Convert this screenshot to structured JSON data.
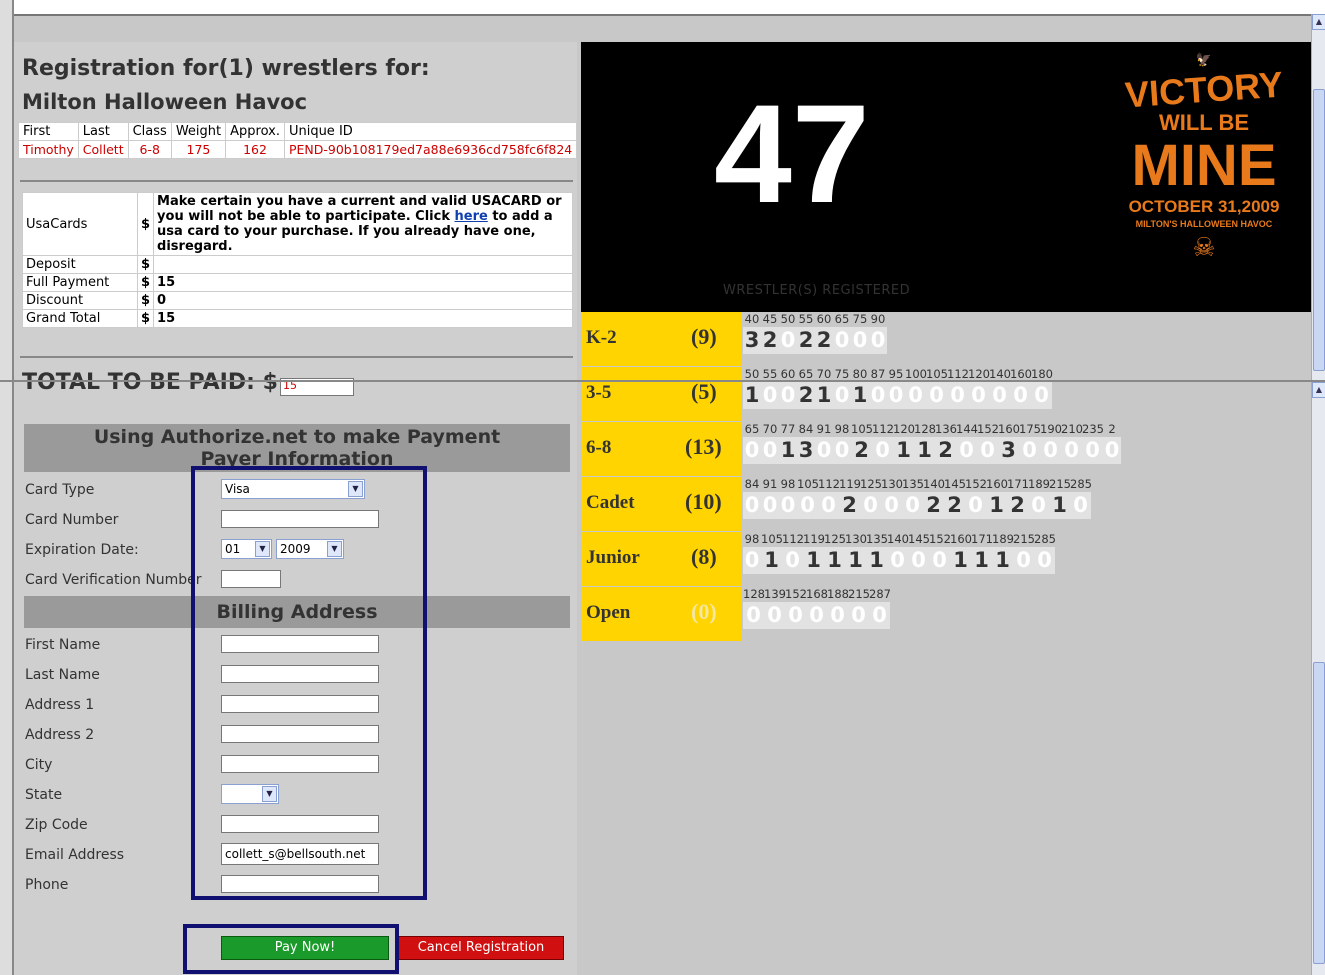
{
  "registration": {
    "title_line1": "Registration for(1) wrestlers for:",
    "title_line2": "Milton Halloween Havoc",
    "headers": [
      "First",
      "Last",
      "Class",
      "Weight",
      "Approx.",
      "Unique ID"
    ],
    "wrestler": [
      "Timothy",
      "Collett",
      "6-8",
      "175",
      "162",
      "PEND-90b108179ed7a88e6936cd758fc6f824"
    ]
  },
  "fees": {
    "usacards_label": "UsaCards",
    "currency": "$",
    "usacard_msg_before": "Make certain you have a current and valid USACARD or you will not be able to participate. Click ",
    "usacard_link": "here",
    "usacard_msg_after": " to add a usa card to your purchase. If you already have one, disregard.",
    "deposit_label": "Deposit",
    "deposit_value": "",
    "full_label": "Full Payment",
    "full_value": "15",
    "discount_label": "Discount",
    "discount_value": "0",
    "grand_label": "Grand Total",
    "grand_value": "15"
  },
  "total": {
    "label": "TOTAL TO BE PAID: $",
    "value": "15"
  },
  "payment": {
    "header_line1": "Using Authorize.net to make Payment",
    "header_line2": "Payer Information",
    "card_type_label": "Card Type",
    "card_type_value": "Visa",
    "card_number_label": "Card Number",
    "exp_label": "Expiration Date:",
    "exp_month": "01",
    "exp_year": "2009",
    "cvn_label": "Card Verification Number"
  },
  "billing": {
    "header": "Billing Address",
    "first_label": "First Name",
    "last_label": "Last Name",
    "addr1_label": "Address 1",
    "addr2_label": "Address 2",
    "city_label": "City",
    "state_label": "State",
    "zip_label": "Zip Code",
    "email_label": "Email Address",
    "email_value": "collett_s@bellsouth.net",
    "phone_label": "Phone"
  },
  "buttons": {
    "pay": "Pay Now!",
    "cancel": "Cancel Registration",
    "pay_color": "#1a9a2a",
    "cancel_color": "#d01010"
  },
  "stats": {
    "count": "47",
    "caption": "WRESTLER(S) REGISTERED",
    "poster": {
      "l1": "VICTORY",
      "l2": "WILL BE",
      "l3": "MINE",
      "l4": "OCTOBER 31,2009",
      "l5": "MILTON'S HALLOWEEN HAVOC"
    }
  },
  "divisions": [
    {
      "name": "K-2",
      "count": "(9)",
      "weights": [
        "40",
        "45",
        "50",
        "55",
        "60",
        "65",
        "75",
        "90"
      ],
      "counts": [
        3,
        2,
        0,
        2,
        2,
        0,
        0,
        0
      ]
    },
    {
      "name": "3-5",
      "count": "(5)",
      "weights": [
        "50",
        "55",
        "60",
        "65",
        "70",
        "75",
        "80",
        "87",
        "95",
        "100",
        "105",
        "112",
        "120",
        "140",
        "160",
        "180"
      ],
      "counts": [
        1,
        0,
        0,
        2,
        1,
        0,
        1,
        0,
        0,
        0,
        0,
        0,
        0,
        0,
        0,
        0
      ]
    },
    {
      "name": "6-8",
      "count": "(13)",
      "weights": [
        "65",
        "70",
        "77",
        "84",
        "91",
        "98",
        "105",
        "112",
        "120",
        "128",
        "136",
        "144",
        "152",
        "160",
        "175",
        "190",
        "210",
        "235",
        "2"
      ],
      "counts": [
        0,
        0,
        1,
        3,
        0,
        0,
        2,
        0,
        1,
        1,
        2,
        0,
        0,
        3,
        0,
        0,
        0,
        0,
        0
      ]
    },
    {
      "name": "Cadet",
      "count": "(10)",
      "weights": [
        "84",
        "91",
        "98",
        "105",
        "112",
        "119",
        "125",
        "130",
        "135",
        "140",
        "145",
        "152",
        "160",
        "171",
        "189",
        "215",
        "285"
      ],
      "counts": [
        0,
        0,
        0,
        0,
        0,
        2,
        0,
        0,
        0,
        2,
        2,
        0,
        1,
        2,
        0,
        1,
        0
      ]
    },
    {
      "name": "Junior",
      "count": "(8)",
      "weights": [
        "98",
        "105",
        "112",
        "119",
        "125",
        "130",
        "135",
        "140",
        "145",
        "152",
        "160",
        "171",
        "189",
        "215",
        "285"
      ],
      "counts": [
        0,
        1,
        0,
        1,
        1,
        1,
        1,
        0,
        0,
        0,
        1,
        1,
        1,
        0,
        0
      ]
    },
    {
      "name": "Open",
      "count": "(0)",
      "weights": [
        "128",
        "139",
        "152",
        "168",
        "188",
        "215",
        "287"
      ],
      "counts": [
        0,
        0,
        0,
        0,
        0,
        0,
        0
      ]
    }
  ],
  "colors": {
    "highlight": "#101070",
    "division_bg": "#ffd400",
    "error_red": "#cc0000",
    "poster_orange": "#e87a1c"
  }
}
